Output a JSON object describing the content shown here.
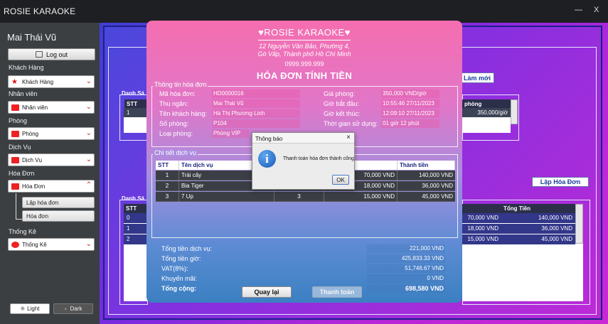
{
  "window": {
    "title": "ROSIE KARAOKE",
    "minimize": "—",
    "close": "X"
  },
  "sidebar": {
    "user_name": "Mai Thái Vũ",
    "logout_label": "Log out",
    "sections": [
      {
        "label": "Khách Hàng",
        "value": "Khách Hàng",
        "icon": "person-star-icon",
        "color": "#d11"
      },
      {
        "label": "Nhân viên",
        "value": "Nhân viên",
        "icon": "employee-card-icon",
        "color": "#d11"
      },
      {
        "label": "Phòng",
        "value": "Phòng",
        "icon": "room-icon",
        "color": "#d11"
      },
      {
        "label": "Dịch Vụ",
        "value": "Dịch Vụ",
        "icon": "service-icon",
        "color": "#d11"
      },
      {
        "label": "Hóa Đơn",
        "value": "Hóa Đơn",
        "icon": "invoice-icon",
        "color": "#d11"
      }
    ],
    "invoice_sub": [
      "Lập hóa đơn",
      "Hóa đơn"
    ],
    "stats": {
      "label": "Thống Kê",
      "value": "Thống Kê",
      "icon": "pie-chart-icon"
    },
    "theme_light": "Light",
    "theme_dark": "Dark"
  },
  "background": {
    "btn_new": "Làm mới",
    "btn_create_invoice": "Lập Hóa Đơn",
    "upper_title": "Danh Sá",
    "upper_header_stt": "STT",
    "upper_header_room": "phòng",
    "upper_row": {
      "stt": "1",
      "price": "350,000/giờ"
    },
    "lower_title": "Danh Sá",
    "lower_header_stt": "STT",
    "lower_header_total": "Tổng Tiền",
    "lower_rows": [
      {
        "stt": "0",
        "price": "70,000 VND",
        "total": "140,000 VND"
      },
      {
        "stt": "1",
        "price": "18,000 VND",
        "total": "36,000 VND"
      },
      {
        "stt": "2",
        "price": "15,000 VND",
        "total": "45,000 VND"
      }
    ]
  },
  "invoice": {
    "brand": "♥ROSIE KARAOKE♥",
    "address_line1": "12 Nguyễn Văn Bảo, Phường 4,",
    "address_line2": "Gò Vấp, Thành phố Hồ Chí Minh",
    "phone": "0999.999.999",
    "title": "HÓA ĐƠN TÍNH TIỀN",
    "info_group_title": "Thông tin hóa đơn",
    "info_left": [
      {
        "label": "Mã hóa đơn:",
        "value": "HD0000016"
      },
      {
        "label": "Thu ngân:",
        "value": "Mai Thái Vũ"
      },
      {
        "label": "Tên khách hàng:",
        "value": "Hà Thị Phương Linh"
      },
      {
        "label": "Số phòng:",
        "value": "P104"
      },
      {
        "label": "Loại phòng:",
        "value": "Phòng VIP"
      }
    ],
    "info_right": [
      {
        "label": "Giá phòng:",
        "value": "350,000 VND/giờ"
      },
      {
        "label": "Giờ bắt đầu:",
        "value": "10:55:46 27/11/2023"
      },
      {
        "label": "Giờ kết thúc:",
        "value": "12:09:10 27/11/2023"
      },
      {
        "label": "Thời gian sử dụng:",
        "value": "01 giờ 12 phút"
      }
    ],
    "service_group_title": "Chi tiết dịch vụ",
    "service_headers": [
      "STT",
      "Tên dịch vụ",
      "",
      "",
      "Thành tiền"
    ],
    "services": [
      {
        "stt": "1",
        "name": "Trái cây",
        "qty": "",
        "price": "70,000 VND",
        "total": "140,000 VND"
      },
      {
        "stt": "2",
        "name": "Bia Tiger",
        "qty": "",
        "price": "18,000 VND",
        "total": "36,000 VND"
      },
      {
        "stt": "3",
        "name": "7 Up",
        "qty": "3",
        "price": "15,000 VND",
        "total": "45,000 VND"
      }
    ],
    "summary": [
      {
        "label": "Tổng tiền dịch vụ:",
        "value": "221,000 VND"
      },
      {
        "label": "Tổng tiền giờ:",
        "value": "425,833.33 VND"
      },
      {
        "label": "VAT(8%):",
        "value": "51,746.67 VND"
      },
      {
        "label": "Khuyến mãi:",
        "value": "0 VND"
      }
    ],
    "grand_total_label": "Tổng cộng:",
    "grand_total_value": "698,580 VND",
    "btn_back": "Quay lại",
    "btn_pay": "Thanh toán"
  },
  "message": {
    "title": "Thông báo",
    "text": "Thanh toán hóa đơn thành công",
    "ok": "OK",
    "icon": "info-icon"
  }
}
